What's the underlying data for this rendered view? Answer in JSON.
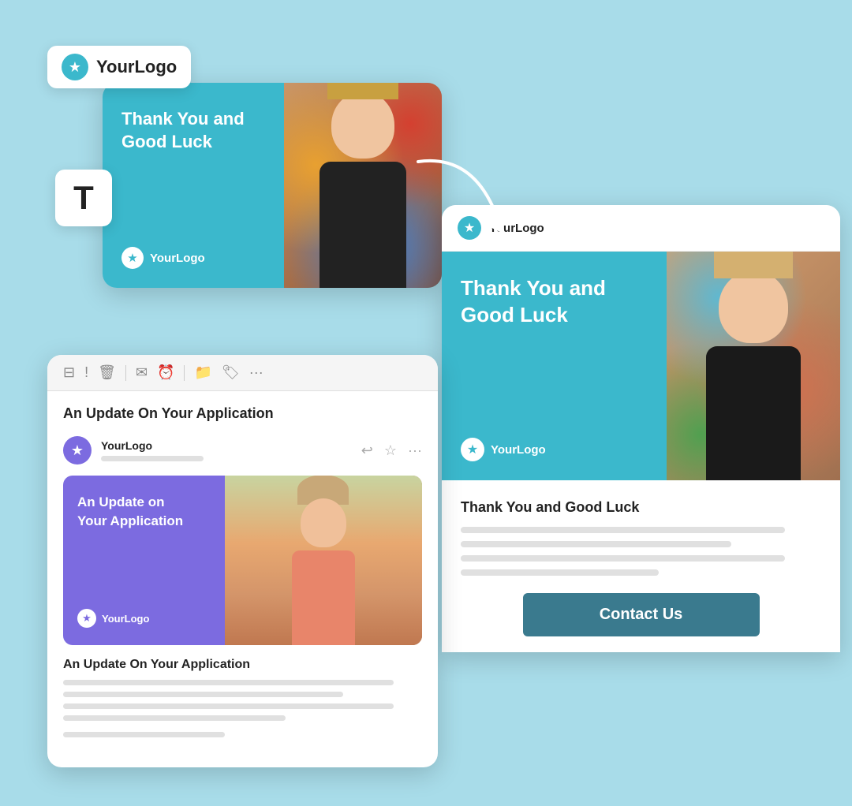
{
  "background": {
    "color": "#a8dce9"
  },
  "logo": {
    "text": "YourLogo",
    "star": "★"
  },
  "card_top": {
    "logo_text": "YourLogo"
  },
  "text_icon": {
    "symbol": "T"
  },
  "email_preview_top": {
    "title": "Thank You and Good Luck",
    "logo": "YourLogo"
  },
  "email_viewer": {
    "header_logo": "YourLogo",
    "banner_title": "Thank You and\nGood Luck",
    "banner_logo": "YourLogo",
    "content_title": "Thank You and Good Luck",
    "contact_btn": "Contact Us"
  },
  "email_client": {
    "subject": "An Update On Your Application",
    "from_name": "YourLogo",
    "mini_card_title": "An Update on\nYour Application",
    "mini_logo": "YourLogo",
    "content_title": "An Update On Your Application",
    "toolbar_icons": [
      "archive",
      "alert",
      "trash",
      "divider",
      "mail",
      "clock",
      "divider",
      "folder",
      "tag",
      "more"
    ]
  }
}
